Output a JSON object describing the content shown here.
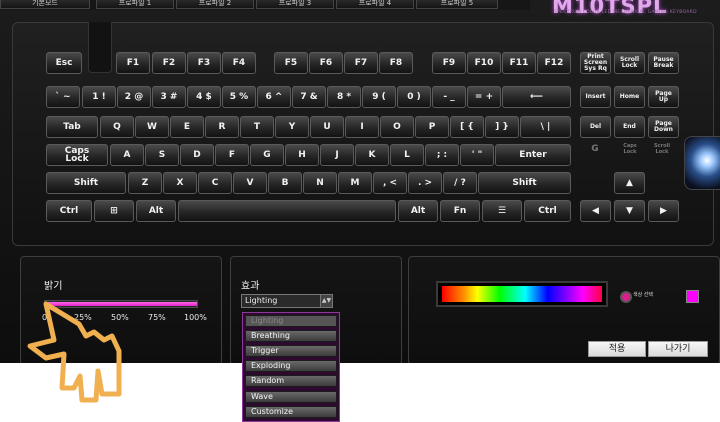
{
  "tabs": [
    "기본모드",
    "프로파일 1",
    "프로파일 2",
    "프로파일 3",
    "프로파일 4",
    "프로파일 5"
  ],
  "brand": {
    "name": "M10TSPL",
    "subtitle": "SPECTRUM COLOR LED MECHANICAL GAMING KEYBOARD"
  },
  "keys": {
    "esc": "Esc",
    "f1": "F1",
    "f2": "F2",
    "f3": "F3",
    "f4": "F4",
    "f5": "F5",
    "f6": "F6",
    "f7": "F7",
    "f8": "F8",
    "f9": "F9",
    "f10": "F10",
    "f11": "F11",
    "f12": "F12",
    "prtsc": "Print\nScreen\nSys Rq",
    "scroll": "Scroll\nLock",
    "pause": "Pause\nBreak",
    "tilde": "` ~",
    "n1": "1 !",
    "n2": "2 @",
    "n3": "3 #",
    "n4": "4 $",
    "n5": "5 %",
    "n6": "6 ^",
    "n7": "7 &",
    "n8": "8 *",
    "n9": "9 (",
    "n0": "0 )",
    "minus": "- _",
    "equal": "= +",
    "backspace": "⟵",
    "insert": "Insert",
    "home": "Home",
    "pgup": "Page\nUp",
    "tab": "Tab",
    "q": "Q",
    "w": "W",
    "e": "E",
    "r": "R",
    "t": "T",
    "y": "Y",
    "u": "U",
    "i": "I",
    "o": "O",
    "p": "P",
    "lbracket": "[ {",
    "rbracket": "] }",
    "backslash": "\\ |",
    "del": "Del",
    "end": "End",
    "pgdn": "Page\nDown",
    "caps": "Caps\nLock",
    "a": "A",
    "s": "S",
    "d": "D",
    "f": "F",
    "g": "G",
    "h": "H",
    "j": "J",
    "k": "K",
    "l": "L",
    "semicolon": "; :",
    "quote": "' \"",
    "enter": "Enter",
    "g_ind": "G",
    "caps_ind": "Caps\nLock",
    "scroll_ind": "Scroll\nLock",
    "lshift": "Shift",
    "z": "Z",
    "x": "X",
    "c": "C",
    "v": "V",
    "b": "B",
    "n": "N",
    "m": "M",
    "comma": ", <",
    "period": ". >",
    "slash": "/ ?",
    "rshift": "Shift",
    "up": "▲",
    "lctrl": "Ctrl",
    "win": "⊞",
    "lalt": "Alt",
    "ralt": "Alt",
    "fn": "Fn",
    "menu": "☰",
    "rctrl": "Ctrl",
    "left": "◀",
    "down": "▼",
    "right": "▶"
  },
  "brightness": {
    "label": "밝기",
    "value_percent": 100,
    "ticks": [
      "0",
      "25%",
      "50%",
      "75%",
      "100%"
    ],
    "fill_color": "#e020c8"
  },
  "effect": {
    "label": "효과",
    "selected": "Lighting",
    "arrow": "▲▼",
    "options": [
      "Lighting",
      "Breathing",
      "Trigger",
      "Exploding",
      "Random",
      "Wave",
      "Customize"
    ]
  },
  "color": {
    "radio_label": "색상 선택",
    "swatch_color": "#ff00ff"
  },
  "buttons": {
    "apply": "적용",
    "exit": "나가기"
  },
  "icons": {
    "cursor": "hand-pointer-icon"
  }
}
